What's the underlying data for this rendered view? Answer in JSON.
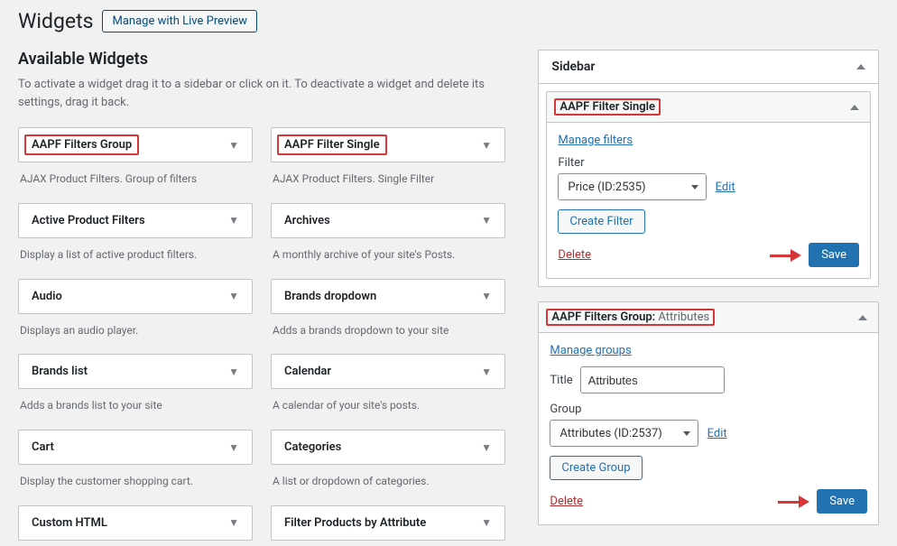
{
  "header": {
    "title": "Widgets",
    "manage_btn": "Manage with Live Preview"
  },
  "available": {
    "title": "Available Widgets",
    "help": "To activate a widget drag it to a sidebar or click on it. To deactivate a widget and delete its settings, drag it back.",
    "left": [
      {
        "name": "AAPF Filters Group",
        "desc": "AJAX Product Filters. Group of filters",
        "highlight": true
      },
      {
        "name": "Active Product Filters",
        "desc": "Display a list of active product filters."
      },
      {
        "name": "Audio",
        "desc": "Displays an audio player."
      },
      {
        "name": "Brands list",
        "desc": "Adds a brands list to your site"
      },
      {
        "name": "Cart",
        "desc": "Display the customer shopping cart."
      },
      {
        "name": "Custom HTML",
        "desc": ""
      }
    ],
    "right": [
      {
        "name": "AAPF Filter Single",
        "desc": "AJAX Product Filters. Single Filter",
        "highlight": true
      },
      {
        "name": "Archives",
        "desc": "A monthly archive of your site's Posts."
      },
      {
        "name": "Brands dropdown",
        "desc": "Adds a brands dropdown to your site"
      },
      {
        "name": "Calendar",
        "desc": "A calendar of your site's posts."
      },
      {
        "name": "Categories",
        "desc": "A list or dropdown of categories."
      },
      {
        "name": "Filter Products by Attribute",
        "desc": ""
      }
    ]
  },
  "sidebar": {
    "title": "Sidebar",
    "panels": [
      {
        "title": "AAPF Filter Single",
        "subtitle": "",
        "manage_link": "Manage filters",
        "filter_label": "Filter",
        "filter_value": "Price (ID:2535)",
        "edit": "Edit",
        "create_btn": "Create Filter",
        "delete": "Delete",
        "save": "Save"
      },
      {
        "title": "AAPF Filters Group",
        "subtitle": "Attributes",
        "manage_link": "Manage groups",
        "title_label": "Title",
        "title_value": "Attributes",
        "group_label": "Group",
        "group_value": "Attributes (ID:2537)",
        "edit": "Edit",
        "create_btn": "Create Group",
        "delete": "Delete",
        "save": "Save"
      }
    ]
  }
}
